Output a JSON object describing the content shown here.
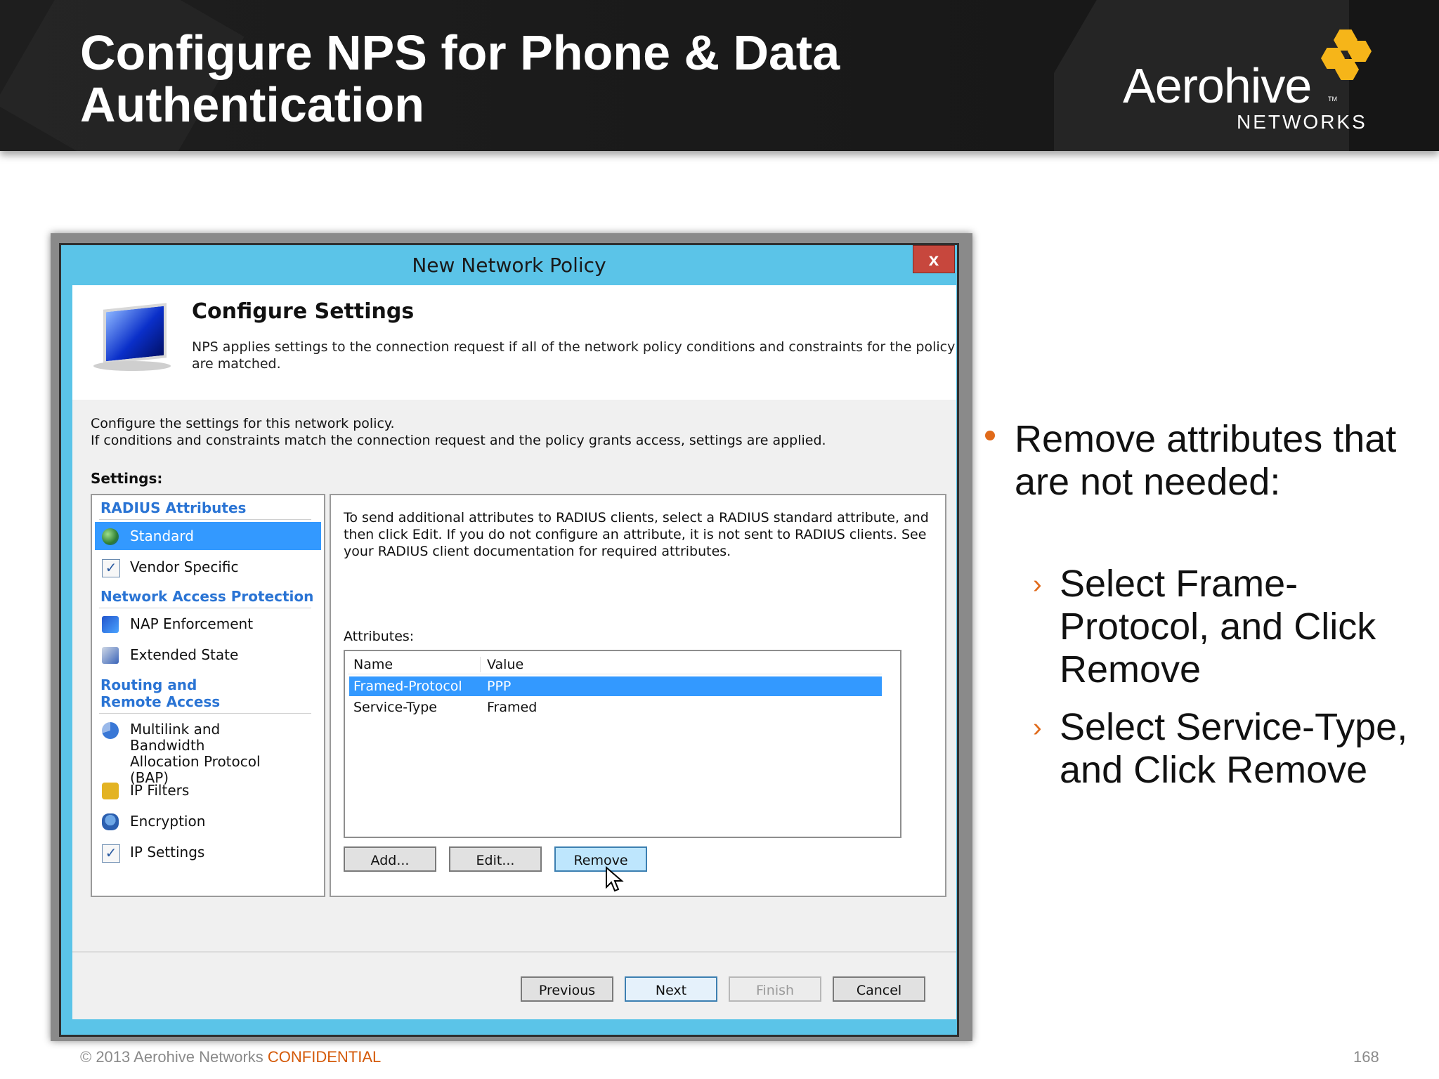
{
  "slide": {
    "title_line1": "Configure NPS for Phone & Data",
    "title_line2": "Authentication",
    "logo_brand": "Aerohive",
    "logo_sub": "NETWORKS",
    "logo_tm": "TM",
    "accent_color": "#f6b519"
  },
  "dialog": {
    "title": "New Network Policy",
    "close_glyph": "x",
    "heading": "Configure Settings",
    "heading_desc": "NPS applies settings to the connection request if all of the network policy conditions and constraints for the policy are matched.",
    "intro_line1": "Configure the settings for this network policy.",
    "intro_line2": "If conditions and constraints match the connection request and the policy grants access, settings are applied.",
    "settings_label": "Settings:",
    "categories": {
      "radius": "RADIUS Attributes",
      "nap": "Network Access Protection",
      "routing": "Routing and Remote Access"
    },
    "items": {
      "standard": "Standard",
      "vendor": "Vendor Specific",
      "nap_enforcement": "NAP Enforcement",
      "extended_state": "Extended State",
      "multilink": "Multilink and Bandwidth Allocation Protocol (BAP)",
      "ip_filters": "IP Filters",
      "encryption": "Encryption",
      "ip_settings": "IP Settings"
    },
    "pane_desc": "To send additional attributes to RADIUS clients, select a RADIUS standard attribute, and then click Edit. If you do not configure an attribute, it is not sent to RADIUS clients. See your RADIUS client documentation for required attributes.",
    "attributes_label": "Attributes:",
    "columns": {
      "name": "Name",
      "value": "Value"
    },
    "rows": [
      {
        "name": "Framed-Protocol",
        "value": "PPP"
      },
      {
        "name": "Service-Type",
        "value": "Framed"
      }
    ],
    "buttons": {
      "add": "Add...",
      "edit": "Edit...",
      "remove": "Remove",
      "previous": "Previous",
      "next": "Next",
      "finish": "Finish",
      "cancel": "Cancel"
    }
  },
  "bullets": {
    "main": "Remove attributes that are not needed:",
    "sub1": "Select Frame-Protocol, and Click Remove",
    "sub2": "Select Service-Type, and Click Remove",
    "sub_marker": "›",
    "bullet_color": "#e06a1a"
  },
  "footer": {
    "copyright": "© 2013 Aerohive Networks ",
    "confidential": "CONFIDENTIAL",
    "page_number": "168"
  }
}
